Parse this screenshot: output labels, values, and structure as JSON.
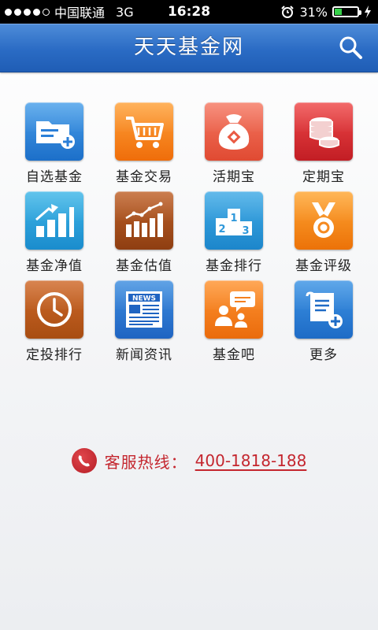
{
  "status_bar": {
    "carrier": "中国联通",
    "network": "3G",
    "time": "16:28",
    "battery_percent": "31%",
    "battery_level": 0.31,
    "signal_bars": 4
  },
  "header": {
    "title": "天天基金网",
    "search_icon": "search-icon"
  },
  "menu": [
    {
      "label": "自选基金",
      "icon": "folder-add-icon",
      "color": "#2a7fd8"
    },
    {
      "label": "基金交易",
      "icon": "shopping-cart-icon",
      "color": "#f5861e"
    },
    {
      "label": "活期宝",
      "icon": "money-bag-icon",
      "color": "#ea5b44"
    },
    {
      "label": "定期宝",
      "icon": "coin-stack-icon",
      "color": "#d42f33"
    },
    {
      "label": "基金净值",
      "icon": "bar-chart-up-icon",
      "color": "#28a0dc"
    },
    {
      "label": "基金估值",
      "icon": "trend-chart-icon",
      "color": "#a54b1a"
    },
    {
      "label": "基金排行",
      "icon": "podium-icon",
      "color": "#2e98da"
    },
    {
      "label": "基金评级",
      "icon": "medal-icon",
      "color": "#f58a20"
    },
    {
      "label": "定投排行",
      "icon": "clock-icon",
      "color": "#bb5a1e"
    },
    {
      "label": "新闻资讯",
      "icon": "newspaper-icon",
      "color": "#2a7ad4"
    },
    {
      "label": "基金吧",
      "icon": "chat-users-icon",
      "color": "#f5801f"
    },
    {
      "label": "更多",
      "icon": "more-doc-icon",
      "color": "#2a7dd5"
    }
  ],
  "news_badge": "NEWS",
  "podium_numbers": [
    "2",
    "1",
    "3"
  ],
  "hotline": {
    "label": "客服热线：",
    "number": "400-1818-188"
  }
}
